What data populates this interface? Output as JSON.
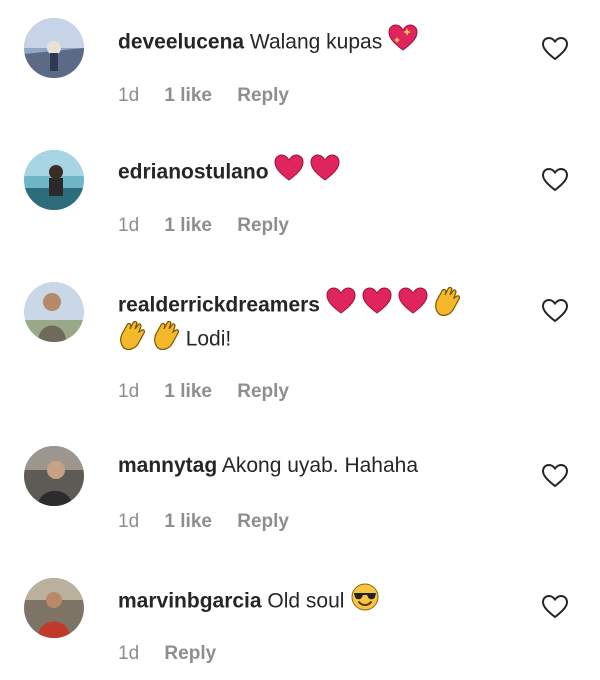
{
  "comments": [
    {
      "username": "deveelucena",
      "text": "Walang kupas",
      "time": "1d",
      "likes": "1 like",
      "reply": "Reply",
      "emojis": [
        "sparkling-heart"
      ]
    },
    {
      "username": "edrianostulano",
      "text": "",
      "time": "1d",
      "likes": "1 like",
      "reply": "Reply",
      "emojis": [
        "red-heart",
        "red-heart"
      ]
    },
    {
      "username": "realderrickdreamers",
      "text": "Lodi!",
      "time": "1d",
      "likes": "1 like",
      "reply": "Reply",
      "emojis": [
        "red-heart",
        "red-heart",
        "red-heart",
        "clapping-hands",
        "clapping-hands",
        "clapping-hands"
      ]
    },
    {
      "username": "mannytag",
      "text": "Akong uyab. Hahaha",
      "time": "1d",
      "likes": "1 like",
      "reply": "Reply",
      "emojis": []
    },
    {
      "username": "marvinbgarcia",
      "text": "Old soul",
      "time": "1d",
      "likes": "",
      "reply": "Reply",
      "emojis": [
        "smiling-face-with-sunglasses"
      ]
    }
  ],
  "colors": {
    "text": "#262626",
    "meta": "#8e8e8e",
    "heart": "#e0245e",
    "clap": "#f4b92b"
  }
}
